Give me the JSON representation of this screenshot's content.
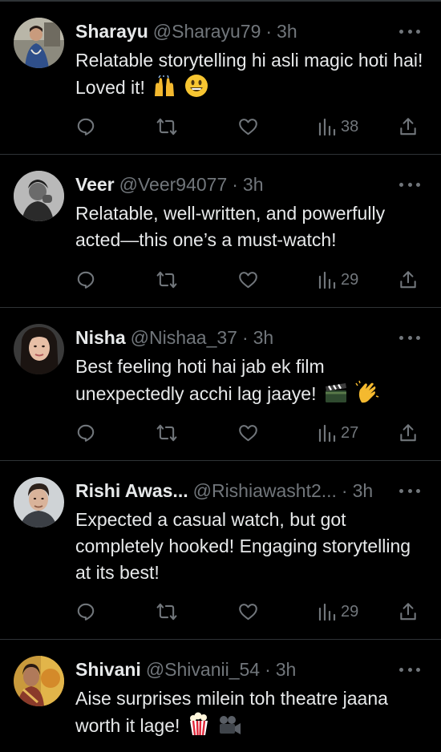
{
  "feed": {
    "tweets": [
      {
        "name": "Sharayu",
        "handle": "@Sharayu79",
        "separator": "·",
        "time": "3h",
        "text": "Relatable storytelling hi asli magic hoti hai! Loved it!",
        "emojis": [
          "raising-hands-emoji",
          "grinning-face-emoji"
        ],
        "views": "38",
        "avatar_icon": "avatar-sharayu"
      },
      {
        "name": "Veer",
        "handle": "@Veer94077",
        "separator": "·",
        "time": "3h",
        "text": "Relatable, well-written, and powerfully acted—this one’s a must-watch!",
        "emojis": [],
        "views": "29",
        "avatar_icon": "avatar-veer"
      },
      {
        "name": "Nisha",
        "handle": "@Nishaa_37",
        "separator": "·",
        "time": "3h",
        "text": "Best feeling hoti hai jab ek film unexpectedly acchi lag jaaye!",
        "emojis": [
          "clapper-board-emoji",
          "clapping-hands-emoji"
        ],
        "views": "27",
        "avatar_icon": "avatar-nisha"
      },
      {
        "name": "Rishi Awas...",
        "handle": "@Rishiawasht2...",
        "separator": "·",
        "time": "3h",
        "text": "Expected a casual watch, but got completely hooked! Engaging storytelling at its best!",
        "emojis": [],
        "views": "29",
        "avatar_icon": "avatar-rishi"
      },
      {
        "name": "Shivani",
        "handle": "@Shivanii_54",
        "separator": "·",
        "time": "3h",
        "text": "Aise surprises milein toh theatre jaana worth it lage!",
        "emojis": [
          "popcorn-emoji",
          "movie-camera-emoji"
        ],
        "views": "",
        "avatar_icon": "avatar-shivani"
      }
    ]
  },
  "colors": {
    "background": "#000000",
    "text": "#e7e9ea",
    "muted": "#71767b",
    "divider": "#2f3336"
  }
}
